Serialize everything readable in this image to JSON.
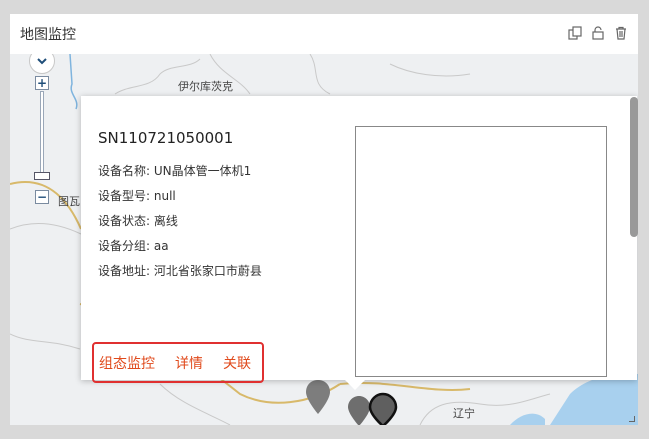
{
  "panel": {
    "title": "地图监控"
  },
  "map": {
    "labels": {
      "place_1": "伊尔库茨克",
      "place_2": "图瓦",
      "place_3": "辽宁"
    },
    "zoom": {
      "in_label": "+",
      "out_label": "−"
    }
  },
  "popup": {
    "serial": "SN110721050001",
    "rows": [
      {
        "label": "设备名称:",
        "value": "UN晶体管一体机1"
      },
      {
        "label": "设备型号:",
        "value": "null"
      },
      {
        "label": "设备状态:",
        "value": "离线"
      },
      {
        "label": "设备分组:",
        "value": "aa"
      },
      {
        "label": "设备地址:",
        "value": "河北省张家口市蔚县"
      }
    ],
    "actions": {
      "config_monitor": "组态监控",
      "details": "详情",
      "link": "关联"
    }
  },
  "colors": {
    "accent_link": "#e04a1c",
    "highlight_border": "#e03030",
    "map_land": "#eef0f2",
    "map_water": "#a8d0ee"
  }
}
